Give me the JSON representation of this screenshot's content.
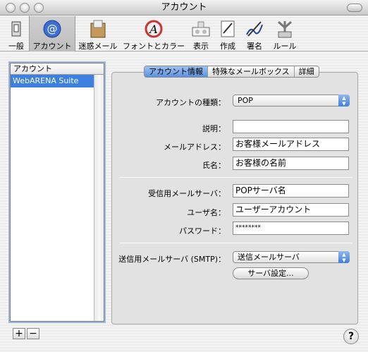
{
  "window": {
    "title": "アカウント"
  },
  "toolbar": {
    "items": [
      {
        "label": "一般",
        "icon": "switch-icon"
      },
      {
        "label": "アカウント",
        "icon": "at-sign-icon"
      },
      {
        "label": "迷惑メール",
        "icon": "junk-mail-icon"
      },
      {
        "label": "フォントとカラー",
        "icon": "font-color-icon"
      },
      {
        "label": "表示",
        "icon": "view-icon"
      },
      {
        "label": "作成",
        "icon": "compose-icon"
      },
      {
        "label": "署名",
        "icon": "signature-icon"
      },
      {
        "label": "ルール",
        "icon": "rules-icon"
      }
    ]
  },
  "accounts": {
    "header": "アカウント",
    "items": [
      {
        "name": "WebARENA Suite"
      }
    ],
    "add_label": "+",
    "remove_label": "−"
  },
  "tabs": {
    "items": [
      {
        "label": "アカウント情報"
      },
      {
        "label": "特殊なメールボックス"
      },
      {
        "label": "詳細"
      }
    ]
  },
  "form": {
    "account_type_label": "アカウントの種類：",
    "account_type_value": "POP",
    "description_label": "説明：",
    "description_value": "",
    "email_label": "メールアドレス：",
    "email_value": "お客様メールアドレス",
    "fullname_label": "氏名：",
    "fullname_value": "お客様の名前",
    "incoming_server_label": "受信用メールサーバ：",
    "incoming_server_value": "POPサーバ名",
    "username_label": "ユーザ名：",
    "username_value": "ユーザーアカウント",
    "password_label": "パスワード：",
    "password_value": "********",
    "smtp_label": "送信用メールサーバ (SMTP)：",
    "smtp_value": "送信メールサーバ",
    "server_settings_button": "サーバ設定..."
  },
  "help": {
    "label": "?"
  },
  "colors": {
    "accent": "#3d80df",
    "selected_row": "#3d80df"
  }
}
